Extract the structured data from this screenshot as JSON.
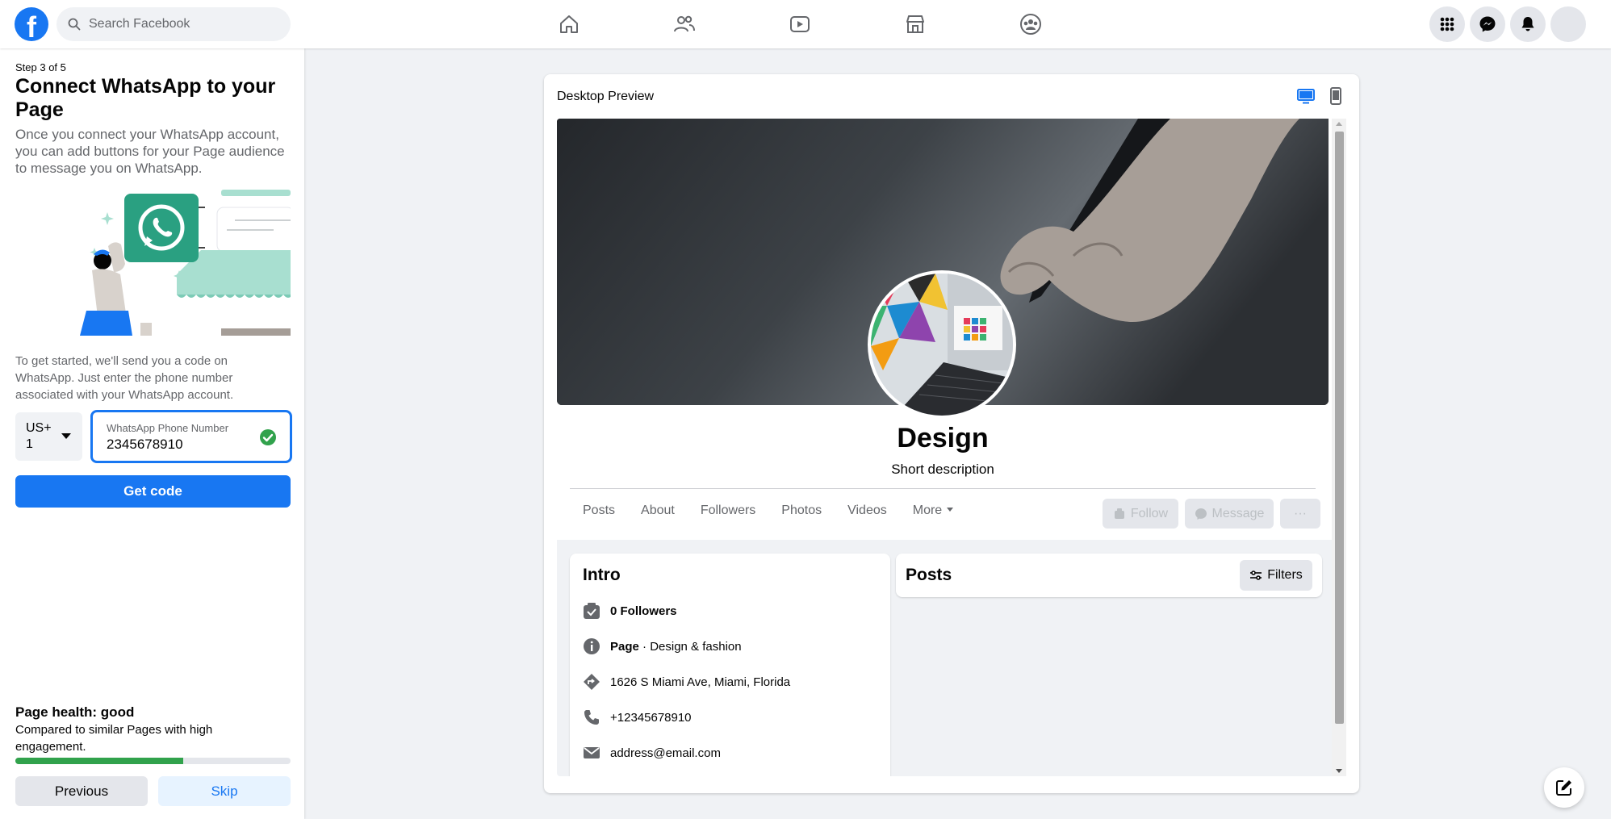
{
  "topbar": {
    "logo_letter": "f",
    "search_placeholder": "Search Facebook",
    "nav": [
      "home-icon",
      "friends-icon",
      "watch-icon",
      "marketplace-icon",
      "groups-icon"
    ],
    "right": [
      "menu-grid-icon",
      "messenger-icon",
      "notifications-icon",
      "account-avatar"
    ]
  },
  "setup": {
    "step": "Step 3 of 5",
    "title": "Connect WhatsApp to your Page",
    "description": "Once you connect your WhatsApp account, you can add buttons for your Page audience to message you on WhatsApp.",
    "instructions": "To get started, we'll send you a code on WhatsApp. Just enter the phone number associated with your WhatsApp account.",
    "country_code_line1": "US+",
    "country_code_line2": "1",
    "phone_label": "WhatsApp Phone Number",
    "phone_value": "2345678910",
    "get_code": "Get code"
  },
  "health": {
    "title": "Page health: good",
    "description": "Compared to similar Pages with high engagement.",
    "progress_fraction": 0.61,
    "progress_color": "#31a24c",
    "previous": "Previous",
    "skip": "Skip"
  },
  "preview": {
    "label": "Desktop Preview",
    "page_name": "Design",
    "short_description": "Short description",
    "tabs": [
      "Posts",
      "About",
      "Followers",
      "Photos",
      "Videos",
      "More"
    ],
    "follow": "Follow",
    "message": "Message",
    "more_dots": "···",
    "intro": {
      "title": "Intro",
      "followers": "0 Followers",
      "category_prefix": "Page",
      "category": " · Design & fashion",
      "address": "1626 S Miami Ave, Miami, Florida",
      "phone": "+12345678910",
      "email": "address@email.com"
    },
    "posts": {
      "title": "Posts",
      "filters": "Filters"
    }
  },
  "colors": {
    "brand_blue": "#1877f2",
    "background": "#f0f2f5"
  }
}
